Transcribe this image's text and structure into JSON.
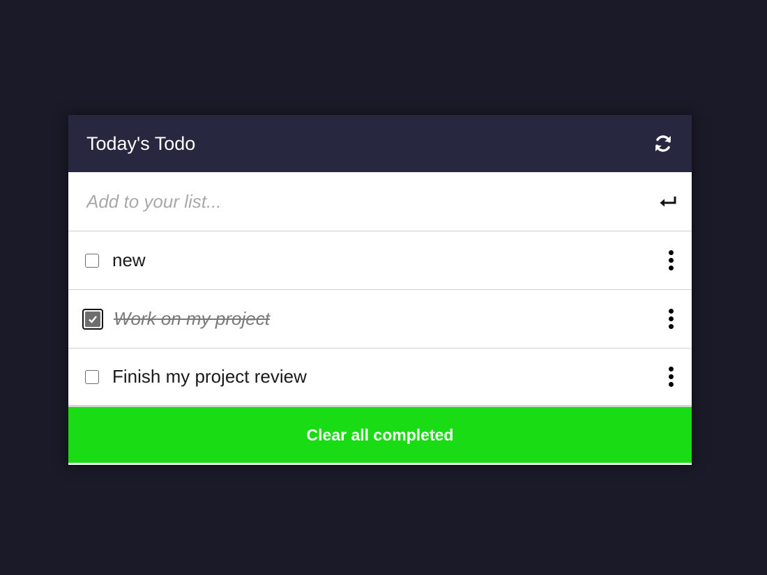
{
  "header": {
    "title": "Today's Todo",
    "refresh_icon": "refresh-icon"
  },
  "add": {
    "placeholder": "Add to your list...",
    "value": "",
    "submit_icon": "enter-icon"
  },
  "todos": [
    {
      "text": "new",
      "completed": false
    },
    {
      "text": "Work on my project",
      "completed": true
    },
    {
      "text": "Finish my project review",
      "completed": false
    }
  ],
  "footer": {
    "clear_label": "Clear all completed"
  },
  "colors": {
    "background": "#1b1a28",
    "header": "#272740",
    "clear_button": "#19dc15"
  }
}
